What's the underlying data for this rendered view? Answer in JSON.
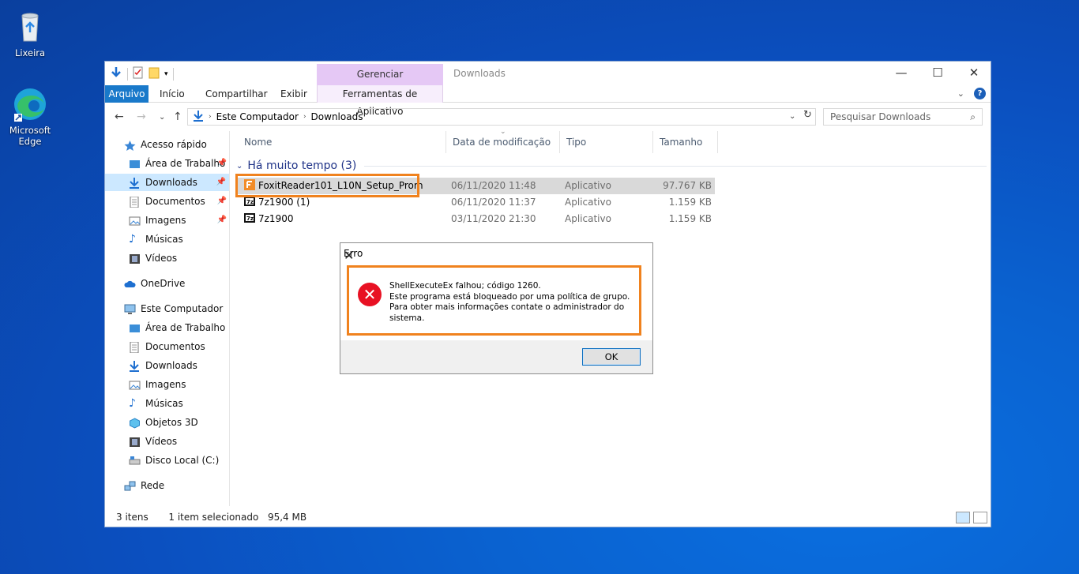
{
  "desktop": {
    "icons": [
      {
        "label": "Lixeira"
      },
      {
        "label": "Microsoft Edge"
      }
    ]
  },
  "explorer": {
    "window_title": "Downloads",
    "contextual_tab": "Gerenciar",
    "tabs": [
      "Arquivo",
      "Início",
      "Compartilhar",
      "Exibir",
      "Ferramentas de Aplicativo"
    ],
    "address": {
      "crumbs": [
        "Este Computador",
        "Downloads"
      ]
    },
    "search_placeholder": "Pesquisar Downloads",
    "nav": {
      "quick_access": "Acesso rápido",
      "quick_items": [
        "Área de Trabalho",
        "Downloads",
        "Documentos",
        "Imagens",
        "Músicas",
        "Vídeos"
      ],
      "onedrive": "OneDrive",
      "this_pc": "Este Computador",
      "pc_items": [
        "Área de Trabalho",
        "Documentos",
        "Downloads",
        "Imagens",
        "Músicas",
        "Objetos 3D",
        "Vídeos",
        "Disco Local (C:)"
      ],
      "network": "Rede"
    },
    "columns": [
      "Nome",
      "Data de modificação",
      "Tipo",
      "Tamanho"
    ],
    "group_label": "Há muito tempo (3)",
    "files": [
      {
        "name": "FoxitReader101_L10N_Setup_Prom",
        "date": "06/11/2020 11:48",
        "type": "Aplicativo",
        "size": "97.767 KB",
        "selected": true
      },
      {
        "name": "7z1900 (1)",
        "date": "06/11/2020 11:37",
        "type": "Aplicativo",
        "size": "1.159 KB",
        "selected": false
      },
      {
        "name": "7z1900",
        "date": "03/11/2020 21:30",
        "type": "Aplicativo",
        "size": "1.159 KB",
        "selected": false
      }
    ],
    "status": {
      "count": "3 itens",
      "selection": "1 item selecionado",
      "size": "95,4 MB"
    }
  },
  "dialog": {
    "title": "Erro",
    "line1": "ShellExecuteEx falhou; código 1260.",
    "line2": "Este programa está bloqueado por uma política de grupo.",
    "line3": "Para obter mais informações contate o administrador do sistema.",
    "ok_label": "OK"
  },
  "colors": {
    "accent": "#1979ca",
    "highlight": "#f0821e",
    "manage_tab": "#e5c8f5",
    "error": "#e81123"
  }
}
